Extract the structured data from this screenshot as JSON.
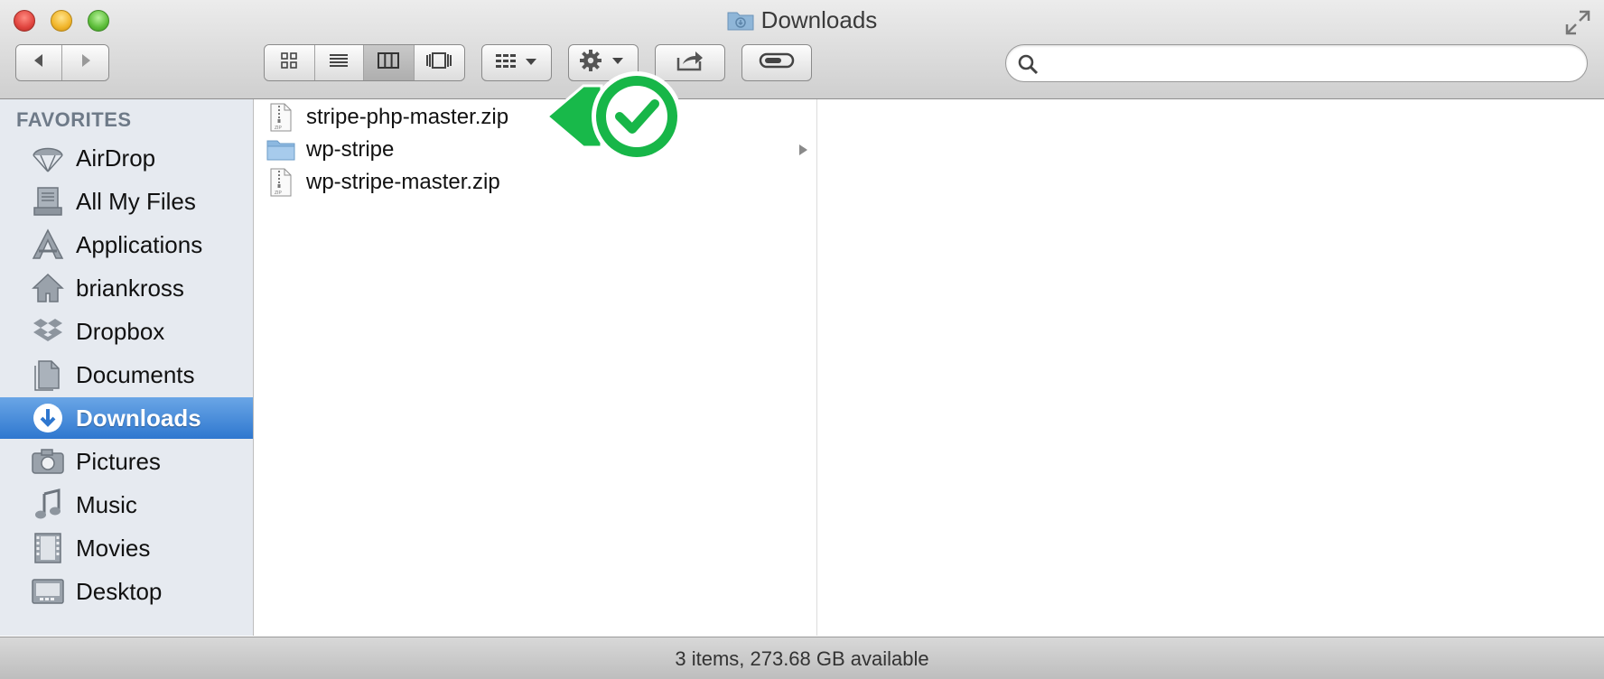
{
  "window": {
    "title": "Downloads",
    "icons": {
      "close": "close-button",
      "minimize": "minimize-button",
      "zoom": "zoom-button",
      "fullscreen": "fullscreen-arrows-icon"
    }
  },
  "toolbar": {
    "back_icon": "chevron-left-icon",
    "forward_icon": "chevron-right-icon",
    "view_modes": [
      "icon-view",
      "list-view",
      "column-view",
      "cover-flow-view"
    ],
    "active_view": "column-view",
    "arrange_icon": "arrange-grid-icon",
    "action_icon": "gear-icon",
    "share_icon": "share-icon",
    "tags_icon": "tag-pill-icon",
    "search": {
      "placeholder": "",
      "value": ""
    }
  },
  "sidebar": {
    "heading": "FAVORITES",
    "items": [
      {
        "label": "AirDrop",
        "icon": "airdrop-icon"
      },
      {
        "label": "All My Files",
        "icon": "all-files-icon"
      },
      {
        "label": "Applications",
        "icon": "applications-icon"
      },
      {
        "label": "briankross",
        "icon": "home-icon"
      },
      {
        "label": "Dropbox",
        "icon": "dropbox-icon"
      },
      {
        "label": "Documents",
        "icon": "documents-icon"
      },
      {
        "label": "Downloads",
        "icon": "downloads-icon",
        "selected": true
      },
      {
        "label": "Pictures",
        "icon": "camera-icon"
      },
      {
        "label": "Music",
        "icon": "music-note-icon"
      },
      {
        "label": "Movies",
        "icon": "film-strip-icon"
      },
      {
        "label": "Desktop",
        "icon": "desktop-icon"
      }
    ]
  },
  "files": [
    {
      "name": "stripe-php-master.zip",
      "type": "zip",
      "icon": "zip-file-icon"
    },
    {
      "name": "wp-stripe",
      "type": "folder",
      "icon": "folder-icon",
      "has_children": true
    },
    {
      "name": "wp-stripe-master.zip",
      "type": "zip",
      "icon": "zip-file-icon"
    }
  ],
  "overlay": {
    "icon": "green-checkmark-badge",
    "color": "#1fb84a"
  },
  "status": {
    "text": "3 items, 273.68 GB available"
  },
  "colors": {
    "selection": "#3b82d6",
    "sidebar_bg": "#e6eaf0",
    "check_green": "#1fb84a"
  }
}
